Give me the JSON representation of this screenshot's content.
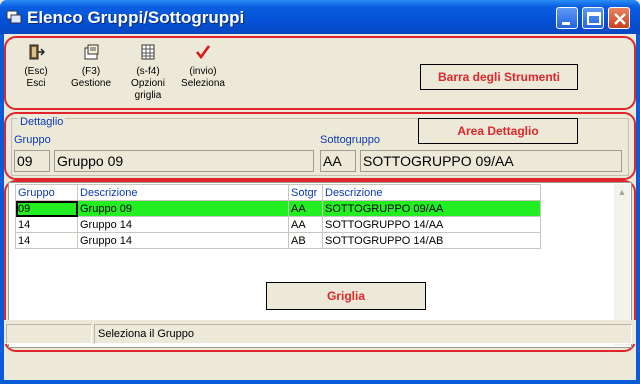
{
  "window": {
    "title": "Elenco Gruppi/Sottogruppi"
  },
  "toolbar": {
    "tools": [
      {
        "key": "(Esc)",
        "label": "Esci",
        "icon": "exit-door-icon"
      },
      {
        "key": "(F3)",
        "label": "Gestione",
        "icon": "edit-document-icon"
      },
      {
        "key": "(s-f4)",
        "label": "Opzioni",
        "label2": "griglia",
        "icon": "grid-options-icon"
      },
      {
        "key": "(invio)",
        "label": "Seleziona",
        "icon": "red-checkmark-icon"
      }
    ],
    "callout": "Barra degli Strumenti"
  },
  "detail": {
    "legend": "Dettaglio",
    "group_label": "Gruppo",
    "subgroup_label": "Sottogruppo",
    "group_code": "09",
    "group_desc": "Gruppo 09",
    "subgroup_code": "AA",
    "subgroup_desc": "SOTTOGRUPPO 09/AA",
    "callout": "Area Dettaglio"
  },
  "grid": {
    "columns": [
      "Gruppo",
      "Descrizione",
      "Sotgr",
      "Descrizione"
    ],
    "rows": [
      [
        "09",
        "Gruppo 09",
        "AA",
        "SOTTOGRUPPO 09/AA"
      ],
      [
        "14",
        "Gruppo 14",
        "AA",
        "SOTTOGRUPPO 14/AA"
      ],
      [
        "14",
        "Gruppo 14",
        "AB",
        "SOTTOGRUPPO 14/AB"
      ]
    ],
    "selected_color": "#22ee22",
    "callout": "Griglia"
  },
  "status": {
    "text": "Seleziona il Gruppo"
  },
  "colors": {
    "accent_red": "#e0262a",
    "label_blue": "#0b3ab0",
    "title_blue": "#0551d6"
  }
}
